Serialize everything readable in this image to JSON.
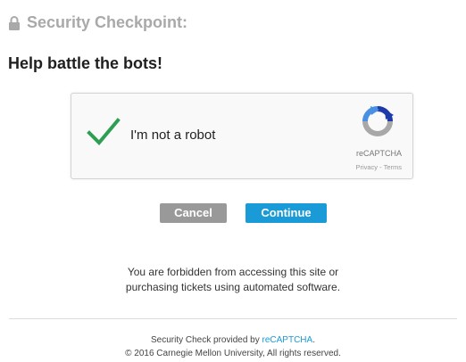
{
  "header": {
    "title": "Security Checkpoint:",
    "icon": "lock-icon"
  },
  "subtitle": "Help battle the bots!",
  "captcha": {
    "label": "I'm not a robot",
    "checked": true,
    "brand": "reCAPTCHA",
    "privacy": "Privacy",
    "separator": " - ",
    "terms": "Terms",
    "check_color": "#2e9e52"
  },
  "buttons": {
    "cancel": "Cancel",
    "continue": "Continue"
  },
  "notice": {
    "line1": "You are forbidden from accessing this site or",
    "line2": "purchasing tickets using automated software."
  },
  "footer": {
    "line1_prefix": "Security Check provided by ",
    "line1_link": "reCAPTCHA",
    "line1_suffix": ".",
    "line2": "© 2016 Carnegie Mellon University, All rights reserved."
  },
  "colors": {
    "accent": "#1a9ad6",
    "cancel_bg": "#999999",
    "header_text": "#a9a9a9"
  }
}
